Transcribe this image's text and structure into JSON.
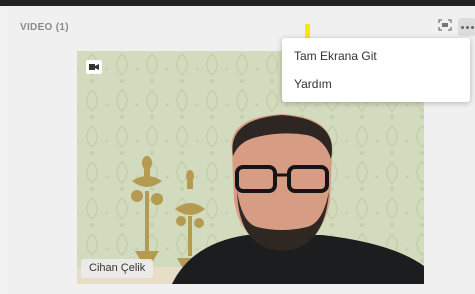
{
  "panel": {
    "title": "VIDEO (1)"
  },
  "toolbar": {
    "fullscreen_icon": "fullscreen-icon",
    "more_icon": "more-options-icon"
  },
  "video": {
    "participant_name": "Cihan Çelik",
    "badge_icon": "camera-icon"
  },
  "menu": {
    "items": [
      {
        "label": "Tam Ekrana Git"
      },
      {
        "label": "Yardım"
      }
    ]
  },
  "colors": {
    "highlight": "#f7ea00",
    "panel_bg": "#f0f0f0",
    "title_text": "#8a8a8a"
  }
}
